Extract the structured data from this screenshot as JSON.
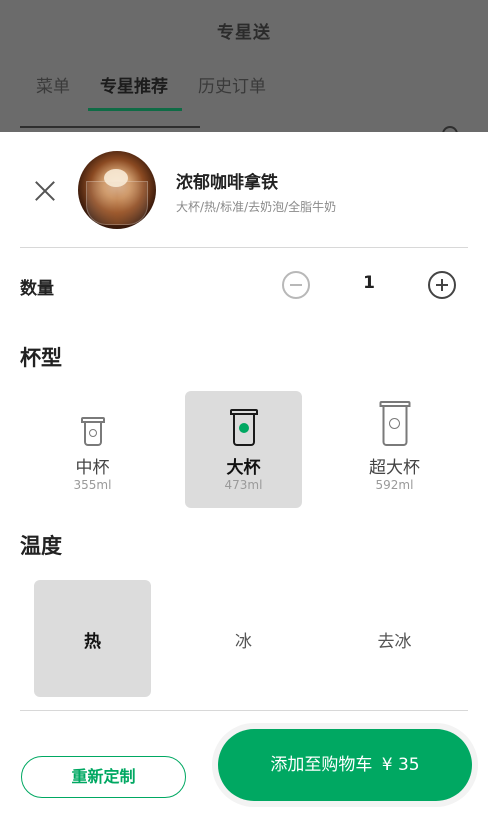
{
  "backdrop": {
    "title": "专星送",
    "tabs": [
      "菜单",
      "专星推荐",
      "历史订单"
    ],
    "active_tab": "专星推荐"
  },
  "product": {
    "name": "浓郁咖啡拿铁",
    "spec": "大杯/热/标准/去奶泡/全脂牛奶",
    "image_icon": "latte-photo"
  },
  "quantity": {
    "label": "数量",
    "value": "1"
  },
  "cup_section": {
    "title": "杯型",
    "options": [
      {
        "name": "中杯",
        "volume": "355ml",
        "selected": false
      },
      {
        "name": "大杯",
        "volume": "473ml",
        "selected": true
      },
      {
        "name": "超大杯",
        "volume": "592ml",
        "selected": false
      }
    ]
  },
  "temp_section": {
    "title": "温度",
    "options": [
      {
        "name": "热",
        "selected": true
      },
      {
        "name": "冰",
        "selected": false
      },
      {
        "name": "去冰",
        "selected": false
      }
    ]
  },
  "footer": {
    "reset_label": "重新定制",
    "add_label": "添加至购物车",
    "price": "¥ 35"
  },
  "colors": {
    "accent": "#00a862",
    "selected_bg": "#dcdcdc",
    "tab_underline": "#0f6b45"
  }
}
